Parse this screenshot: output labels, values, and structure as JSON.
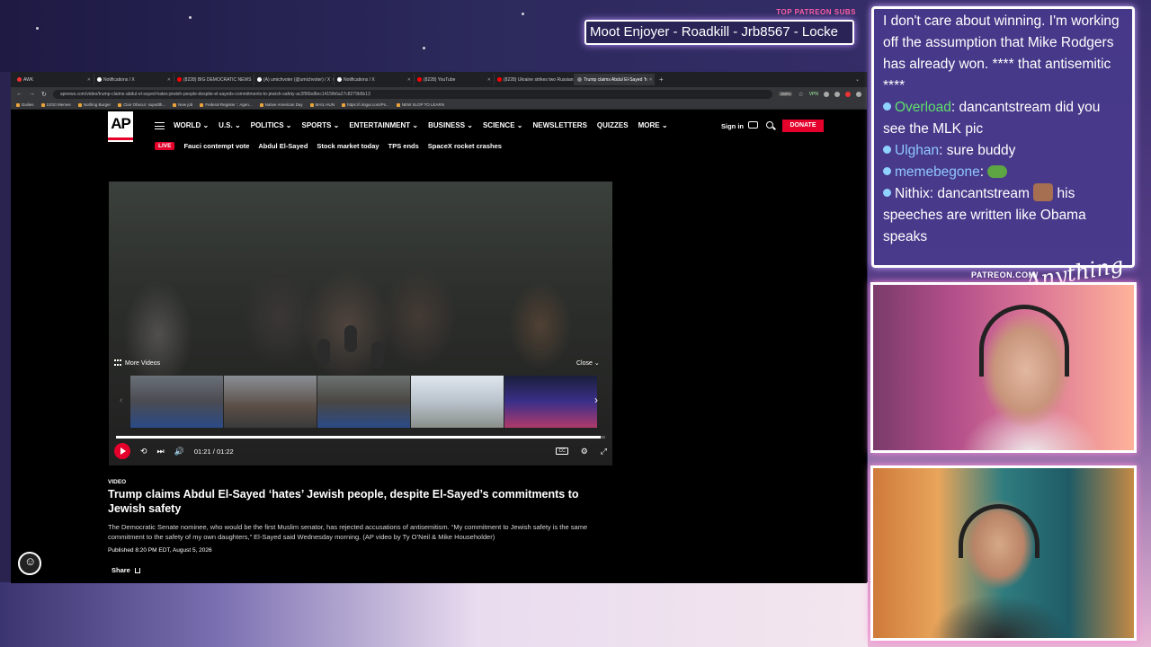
{
  "stream": {
    "top_patreon_label": "TOP PATREON SUBS",
    "subs_ticker": "Moot Enjoyer - Roadkill - Jrb8567 - Locke",
    "patreon_url_label": "PATREON.COM/",
    "brand_logo": "Anything"
  },
  "browser": {
    "tabs": [
      {
        "label": "AWK",
        "fav": "#e33"
      },
      {
        "label": "Notifications / X",
        "fav": "#fff"
      },
      {
        "label": "(8228) BIG DEMOCRATIC NEWS",
        "fav": "#f00"
      },
      {
        "label": "(A) umichvoter (@umichvoter) / X",
        "fav": "#fff"
      },
      {
        "label": "Notifications / X",
        "fav": "#fff"
      },
      {
        "label": "(8228) YouTube",
        "fav": "#f00"
      },
      {
        "label": "(8228) Ukraine strikes two Russian",
        "fav": "#f00"
      },
      {
        "label": "Trump claims Abdul El-Sayed 'h",
        "fav": "#888",
        "active": true
      }
    ],
    "new_tab": "+",
    "url": "apnews.com/video/trump-claims-abdul-el-sayed-hates-jewish-people-despite-el-sayeds-commitments-to-jewish-safety-ac2f56bd6ec1415fb6a27c8279b5b13",
    "zoom": "150%",
    "vpn_label": "VPN",
    "bookmarks": [
      "Dailies",
      "10/10 Memes",
      "Nothing Burger",
      "Clair Obscur: supsdth...",
      "New job",
      "Federal Register :: Agen...",
      "Native American Day",
      "MAIL HUN",
      "https://i.imgur.com/Ps...",
      "NEW SLOP TO LEARN"
    ]
  },
  "ap": {
    "logo": "AP",
    "nav": [
      "WORLD",
      "U.S.",
      "POLITICS",
      "SPORTS",
      "ENTERTAINMENT",
      "BUSINESS",
      "SCIENCE",
      "NEWSLETTERS",
      "QUIZZES",
      "MORE"
    ],
    "sign_in": "Sign in",
    "donate": "DONATE",
    "live_label": "LIVE",
    "trending": [
      "Fauci contempt vote",
      "Abdul El-Sayed",
      "Stock market today",
      "TPS ends",
      "SpaceX rocket crashes"
    ],
    "player": {
      "more_videos": "More Videos",
      "close": "Close",
      "time_current": "01:21",
      "time_total": "01:22",
      "time_separator": "/",
      "progress": 0.99
    },
    "article": {
      "kicker": "VIDEO",
      "headline": "Trump claims Abdul El-Sayed ‘hates’ Jewish people, despite El-Sayed’s commitments to Jewish safety",
      "caption": "The Democratic Senate nominee, who would be the first Muslim senator, has rejected accusations of antisemitism. “My commitment to Jewish safety is the same commitment to the safety of my own daughters,” El-Sayed said Wednesday morning. (AP video by Ty O’Neil & Mike Householder)",
      "published": "Published 8:20 PM EDT, August 5, 2026",
      "share": "Share"
    }
  },
  "chat": [
    {
      "user": "",
      "text": "I don't care about winning. I'm working off the assumption that Mike Rodgers has already won. **** that antisemitic ****",
      "color": "#ffffff"
    },
    {
      "user": "Overload",
      "text": ": dancantstream did you see the MLK pic",
      "color": "#5ee06a"
    },
    {
      "user": "Ulghan",
      "text": ": sure buddy",
      "color": "#8fc7ff"
    },
    {
      "user": "memebegone",
      "text": ": ",
      "color": "#8fc7ff",
      "emote": "pepe"
    },
    {
      "user": "Nithix",
      "text": ": dancantstream ",
      "after": " his speeches are written like Obama speaks",
      "color": "#ffffff",
      "emote": "face"
    }
  ]
}
